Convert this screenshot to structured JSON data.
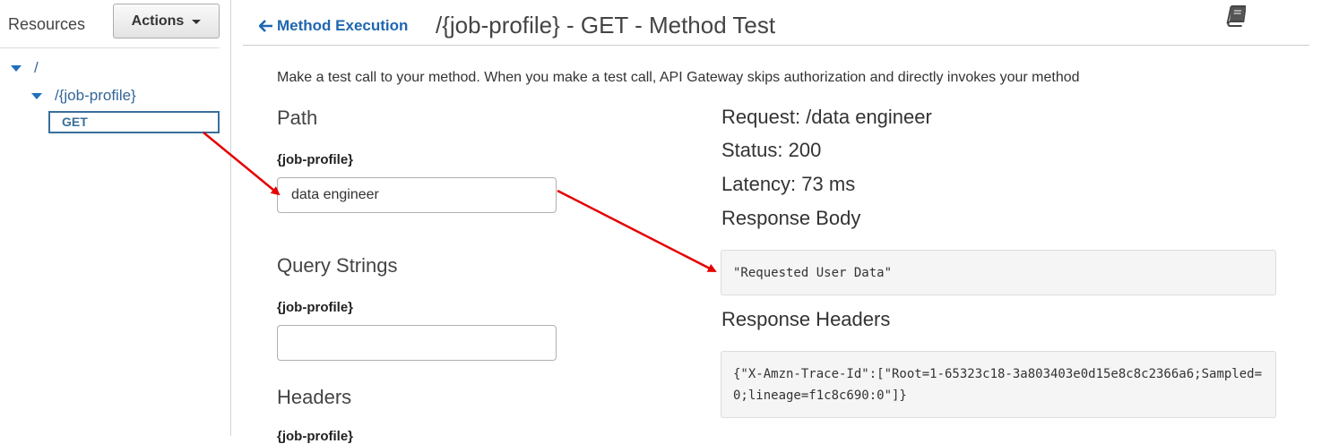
{
  "sidebar": {
    "title": "Resources",
    "actions_label": "Actions",
    "tree": {
      "root": "/",
      "resource": "/{job-profile}",
      "method": "GET"
    }
  },
  "header": {
    "back_link": "Method Execution",
    "title": "/{job-profile} - GET - Method Test"
  },
  "main": {
    "intro": "Make a test call to your method. When you make a test call, API Gateway skips authorization and directly invokes your method",
    "path": {
      "heading": "Path",
      "label": "{job-profile}",
      "value": "data engineer"
    },
    "query_strings": {
      "heading": "Query Strings",
      "label": "{job-profile}",
      "value": ""
    },
    "headers": {
      "heading": "Headers",
      "label": "{job-profile}"
    }
  },
  "result": {
    "request": "Request: /data engineer",
    "status": "Status: 200",
    "latency": "Latency: 73 ms",
    "response_body_heading": "Response Body",
    "response_body": "\"Requested User Data\"",
    "response_headers_heading": "Response Headers",
    "response_headers": "{\"X-Amzn-Trace-Id\":[\"Root=1-65323c18-3a803403e0d15e8c8c2366a6;Sampled=0;lineage=f1c8c690:0\"]}"
  },
  "colors": {
    "link_blue": "#1f66b0",
    "annotation_red": "#e60000"
  },
  "icons": [
    "chevron-down-icon",
    "caret-down-icon",
    "arrow-left-icon",
    "book-icon"
  ]
}
